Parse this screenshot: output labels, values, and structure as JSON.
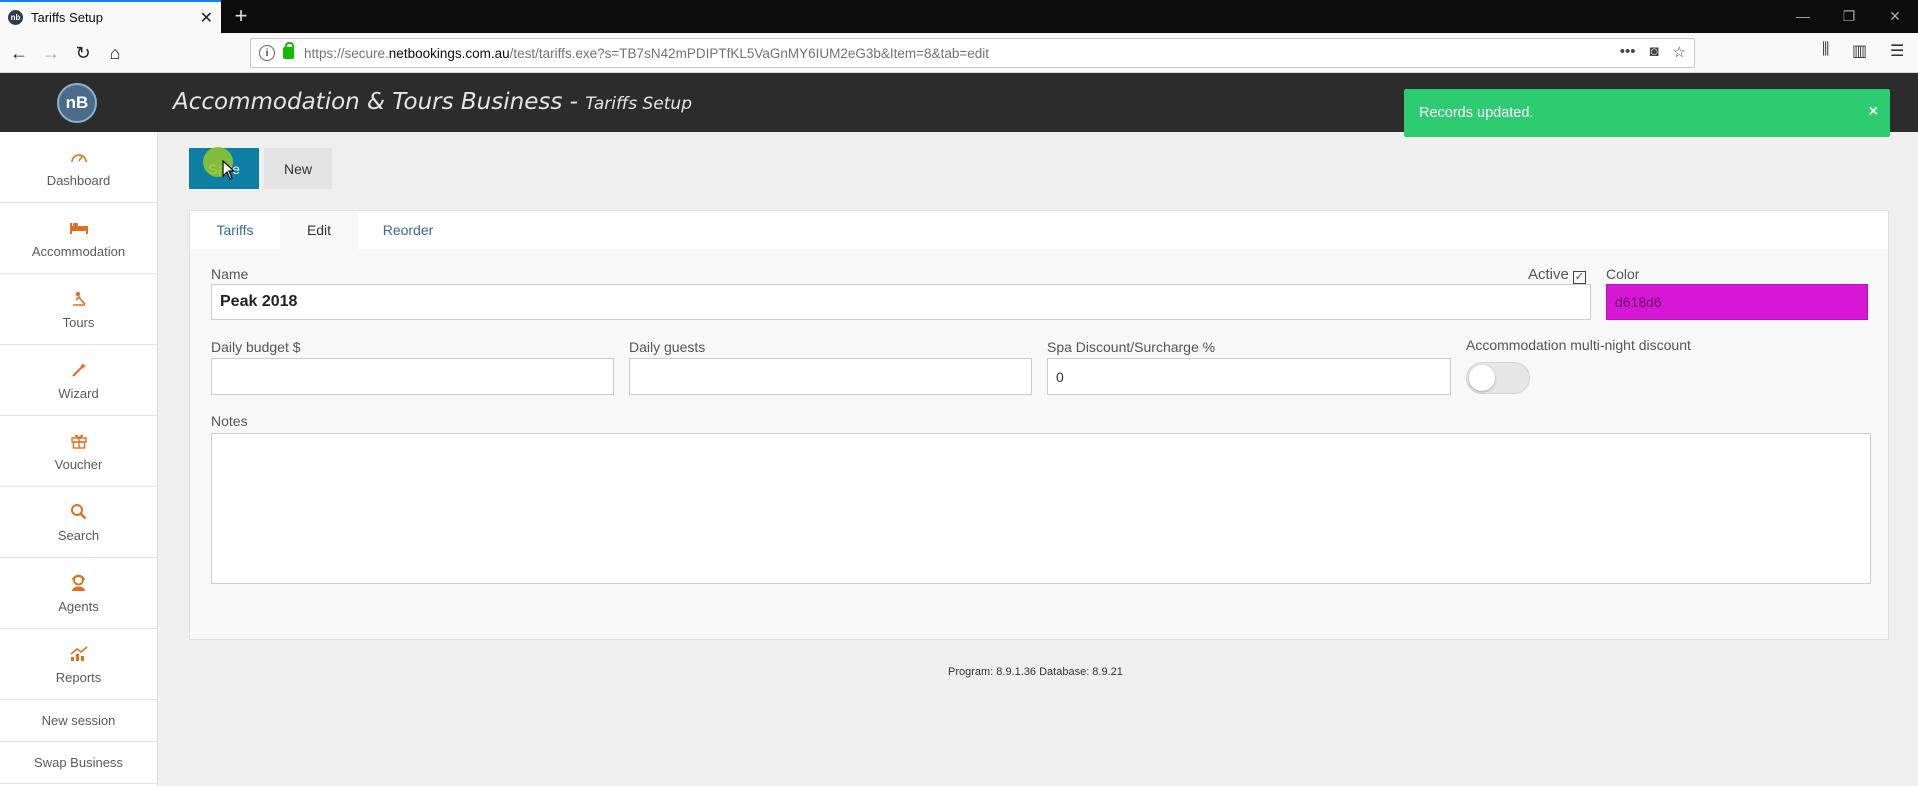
{
  "browser": {
    "tab_title": "Tariffs Setup",
    "tab_favicon": "nb",
    "url_prefix": "https://secure.",
    "url_domain": "netbookings.com.au",
    "url_suffix": "/test/tariffs.exe?s=TB7sN42mPDIPTfKL5VaGnMY6IUM2eG3b&Item=8&tab=edit"
  },
  "app": {
    "logo": "nB",
    "title": "Accommodation & Tours Business - ",
    "subtitle": "Tariffs Setup"
  },
  "toast": {
    "message": "Records updated.",
    "close": "×",
    "color": "#2ecc71"
  },
  "sidebar": {
    "items": [
      {
        "label": "Dashboard",
        "icon": "dashboard-icon"
      },
      {
        "label": "Accommodation",
        "icon": "bed-icon"
      },
      {
        "label": "Tours",
        "icon": "tours-icon"
      },
      {
        "label": "Wizard",
        "icon": "wand-icon"
      },
      {
        "label": "Voucher",
        "icon": "gift-icon"
      },
      {
        "label": "Search",
        "icon": "search-icon"
      },
      {
        "label": "Agents",
        "icon": "agent-icon"
      },
      {
        "label": "Reports",
        "icon": "chart-icon"
      }
    ],
    "new_session": "New session",
    "swap_business": "Swap Business"
  },
  "toolbar": {
    "save_label": "Save",
    "new_label": "New"
  },
  "tabs": [
    {
      "label": "Tariffs",
      "active": false
    },
    {
      "label": "Edit",
      "active": true
    },
    {
      "label": "Reorder",
      "active": false
    }
  ],
  "form": {
    "name_label": "Name",
    "name_value": "Peak 2018",
    "active_label": "Active",
    "active_checked": true,
    "color_label": "Color",
    "color_value": "d618d6",
    "daily_budget_label": "Daily budget $",
    "daily_budget_value": "",
    "daily_guests_label": "Daily guests",
    "daily_guests_value": "",
    "spa_label": "Spa Discount/Surcharge %",
    "spa_value": "0",
    "multinight_label": "Accommodation multi-night discount",
    "multinight_on": false,
    "notes_label": "Notes",
    "notes_value": ""
  },
  "footer": {
    "version": "Program: 8.9.1.36 Database: 8.9.21"
  },
  "colors": {
    "save_button": "#0d7fa5",
    "header": "#2c2c2c",
    "accent_icon": "#e07020"
  }
}
